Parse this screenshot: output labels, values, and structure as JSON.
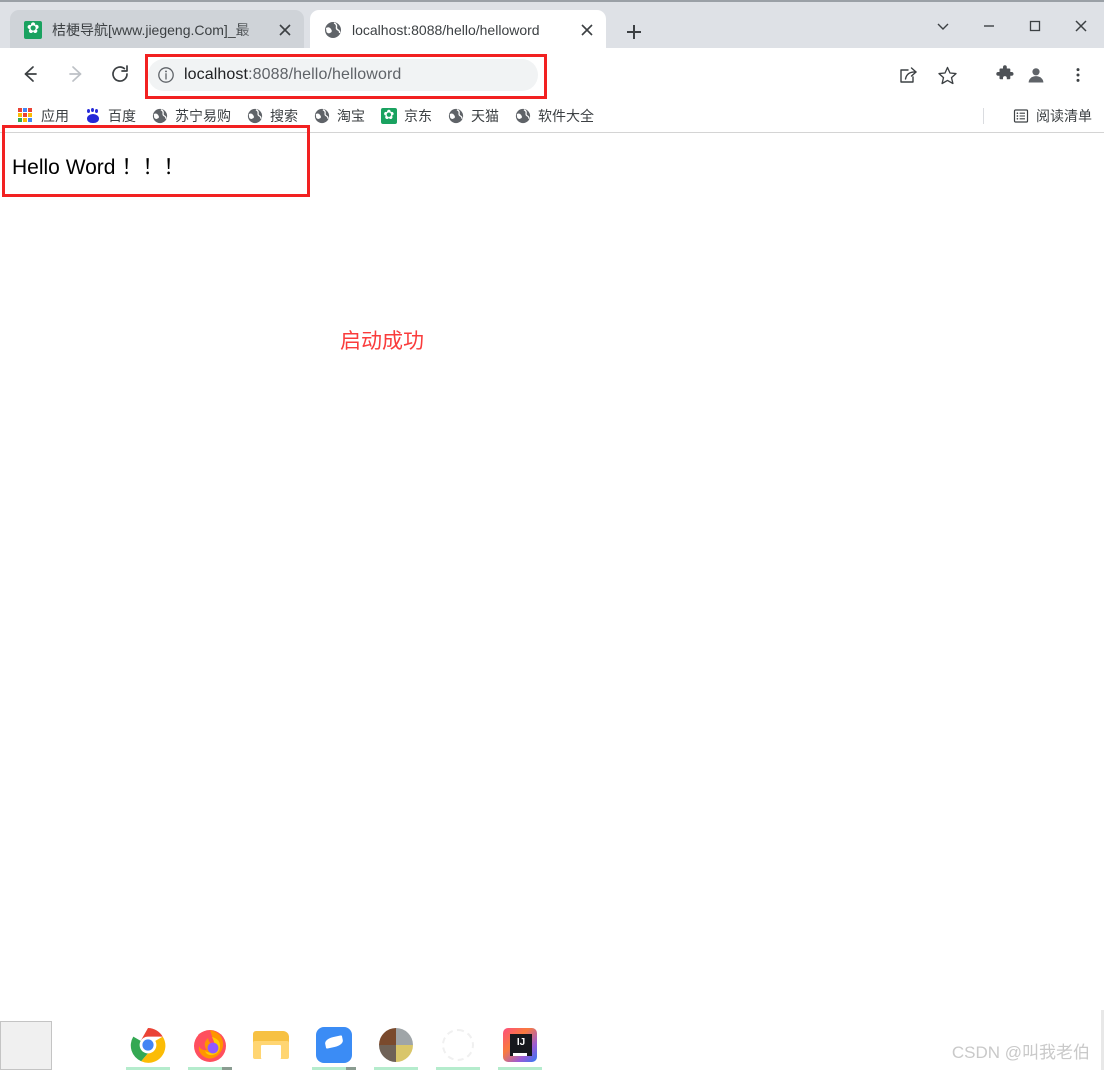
{
  "window": {
    "controls": [
      {
        "name": "tab-search",
        "glyph": "chevron-down"
      },
      {
        "name": "minimize",
        "glyph": "minus"
      },
      {
        "name": "maximize",
        "glyph": "square"
      },
      {
        "name": "close",
        "glyph": "x"
      }
    ]
  },
  "tabs": [
    {
      "title": "桔梗导航[www.jiegeng.Com]_最",
      "favicon": "green-flower-favicon",
      "active": false,
      "close_label": "×"
    },
    {
      "title": "localhost:8088/hello/helloword",
      "favicon": "globe-favicon",
      "active": true,
      "close_label": "×"
    }
  ],
  "new_tab": {
    "label": "+",
    "icon": "plus-icon"
  },
  "toolbar": {
    "back_icon": "arrow-left-icon",
    "forward_icon": "arrow-right-icon",
    "reload_icon": "reload-icon",
    "share_icon": "share-icon",
    "bookmark_icon": "star-icon",
    "extensions_icon": "puzzle-icon",
    "profile_icon": "person-icon",
    "menu_icon": "three-dots-icon"
  },
  "omnibox": {
    "site_info_icon": "info-circle-icon",
    "url_host": "localhost",
    "url_path": ":8088/hello/helloword",
    "full_url": "localhost:8088/hello/helloword"
  },
  "bookmarks": [
    {
      "label": "应用",
      "icon": "apps-grid-icon",
      "color": "#4285f4"
    },
    {
      "label": "百度",
      "icon": "baidu-paw-icon",
      "color": "#2529d8"
    },
    {
      "label": "苏宁易购",
      "icon": "globe-icon",
      "color": "#5f6368"
    },
    {
      "label": "搜索",
      "icon": "globe-icon",
      "color": "#5f6368"
    },
    {
      "label": "淘宝",
      "icon": "globe-icon",
      "color": "#5f6368"
    },
    {
      "label": "京东",
      "icon": "jd-flower-icon",
      "color": "#1aa260"
    },
    {
      "label": "天猫",
      "icon": "globe-icon",
      "color": "#5f6368"
    },
    {
      "label": "软件大全",
      "icon": "globe-icon",
      "color": "#5f6368"
    }
  ],
  "reading_list": {
    "label": "阅读清单",
    "icon": "reading-list-icon"
  },
  "page": {
    "heading": "Hello Word ！！！",
    "annotation": "启动成功",
    "annotation_color": "#fa3c3c",
    "highlight_color": "#f22121"
  },
  "taskbar": {
    "items": [
      {
        "name": "chrome",
        "icon": "chrome-icon"
      },
      {
        "name": "firefox",
        "icon": "firefox-icon"
      },
      {
        "name": "file-explorer",
        "icon": "folder-icon"
      },
      {
        "name": "editor",
        "icon": "blue-editor-icon"
      },
      {
        "name": "photos",
        "icon": "photo-collage-icon"
      },
      {
        "name": "faint-app",
        "icon": "faint-gear-icon"
      },
      {
        "name": "intellij-idea",
        "icon": "idea-icon"
      }
    ]
  },
  "watermark": {
    "text": "CSDN @叫我老伯"
  }
}
